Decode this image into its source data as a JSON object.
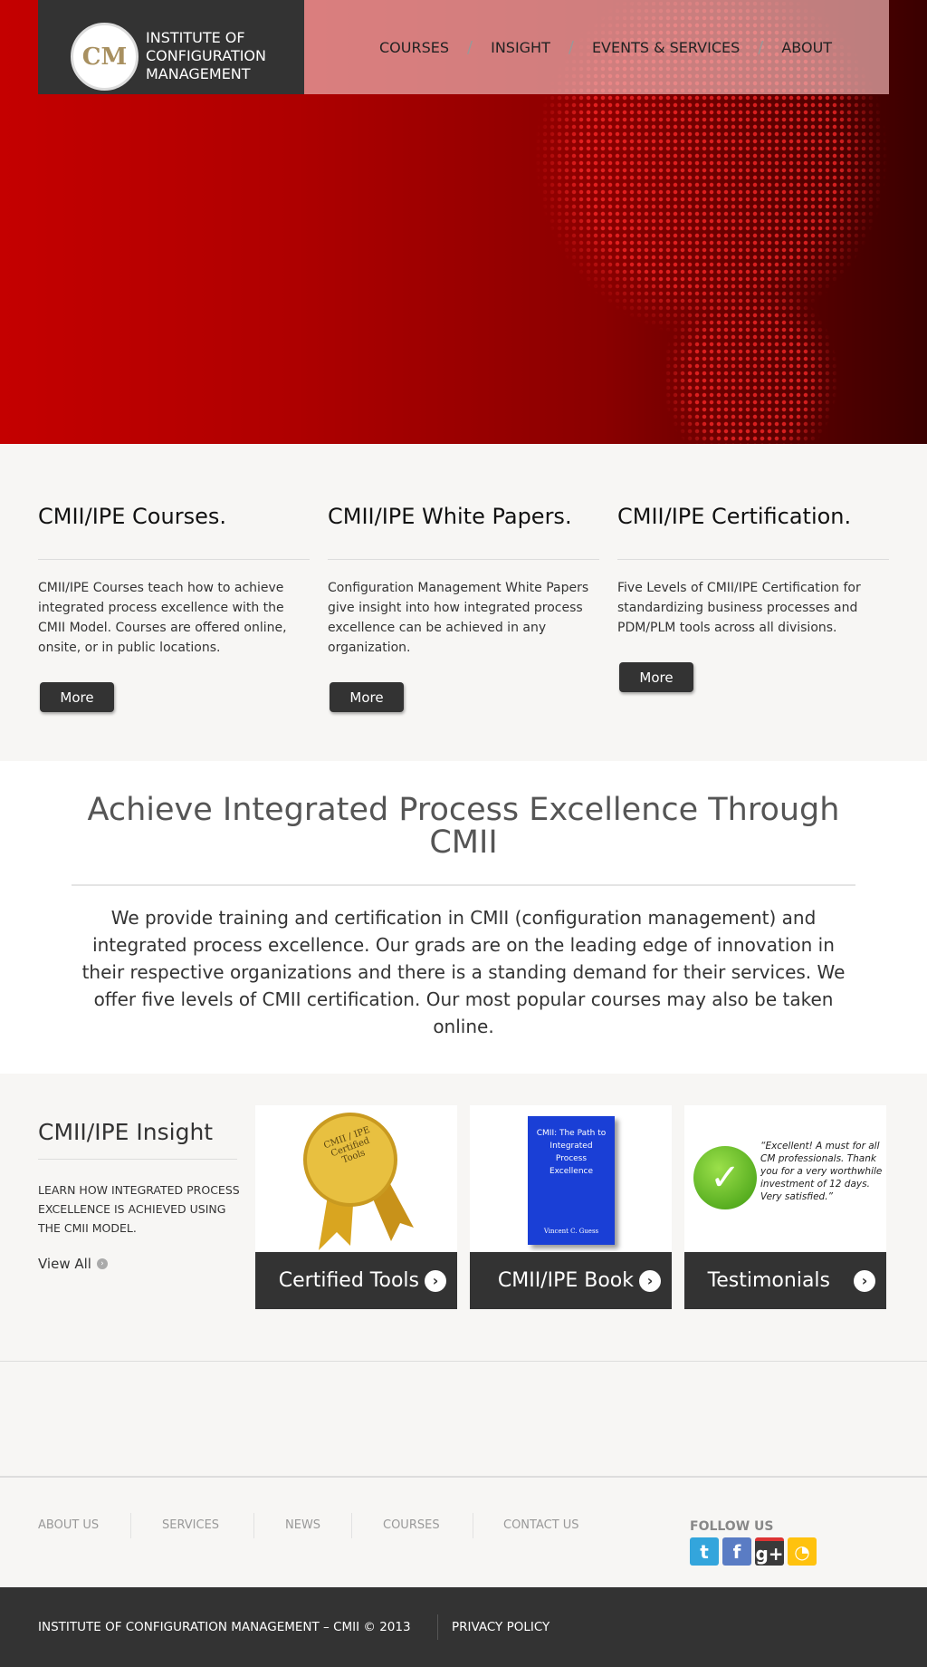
{
  "header": {
    "logo_text": [
      "INSTITUTE OF",
      "CONFIGURATION",
      "MANAGEMENT"
    ],
    "logo_mark": "CM",
    "nav": [
      "COURSES",
      "INSIGHT",
      "EVENTS & SERVICES",
      "ABOUT"
    ]
  },
  "features": [
    {
      "title": "CMII/IPE Courses.",
      "text": "CMII/IPE Courses teach how to achieve integrated process excellence with the CMII Model. Courses are offered online, onsite, or in public locations.",
      "button": "More"
    },
    {
      "title": "CMII/IPE White Papers.",
      "text": "Configuration Management White Papers give insight into how integrated process excellence can be achieved in any organization.",
      "button": "More"
    },
    {
      "title": "CMII/IPE Certification.",
      "text": "Five Levels of CMII/IPE Certification for standardizing business processes and PDM/PLM tools across all divisions.",
      "button": "More"
    }
  ],
  "intro": {
    "heading": "Achieve Integrated Process Excellence Through CMII",
    "text": "We provide training and certification in CMII (configuration management) and integrated process excellence. Our grads are on the leading edge of innovation in their respective organizations and there is a standing demand for their services. We offer five levels of CMII certification. Our most popular courses may also be taken online."
  },
  "insight": {
    "title": "CMII/IPE Insight",
    "text": "LEARN HOW INTEGRATED PROCESS EXCELLENCE IS ACHIEVED USING THE CMII MODEL.",
    "view_all": "View All",
    "cards": [
      {
        "label": "Certified Tools",
        "image_text": "CMII / IPE Certified Tools"
      },
      {
        "label": "CMII/IPE Book",
        "image_text": "CMII: The Path to Integrated Process Excellence",
        "author": "Vincent C. Guess"
      },
      {
        "label": "Testimonials",
        "image_text": "“Excellent! A must for all CM professionals. Thank you for a very worthwhile investment of 12 days. Very satisfied.”"
      }
    ]
  },
  "footer": {
    "links": [
      "ABOUT US",
      "SERVICES",
      "NEWS",
      "COURSES",
      "CONTACT US"
    ],
    "follow_title": "FOLLOW US",
    "social": [
      {
        "icon": "twitter-icon",
        "color": "#33a5dc"
      },
      {
        "icon": "facebook-icon",
        "color": "#5a7cc4"
      },
      {
        "icon": "google-plus-icon",
        "color": "#3a3a3a"
      },
      {
        "icon": "rss-icon",
        "color": "#ffc20e"
      }
    ],
    "copyright": "INSTITUTE OF CONFIGURATION MANAGEMENT – CMII © 2013",
    "privacy": "PRIVACY POLICY"
  }
}
